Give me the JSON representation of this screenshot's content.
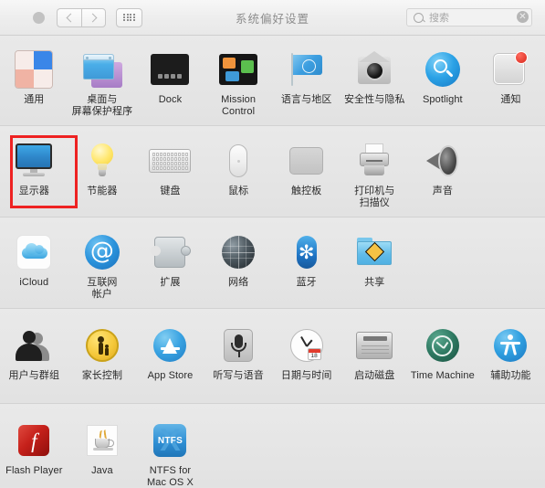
{
  "window": {
    "title": "系统偏好设置"
  },
  "toolbar": {
    "back_icon": "chevron-left-icon",
    "forward_icon": "chevron-right-icon",
    "show_all_icon": "grid-icon",
    "search": {
      "placeholder": "搜索",
      "value": "",
      "clear_label": "✕"
    }
  },
  "rows": [
    {
      "id": "row-personal",
      "items": [
        {
          "label": "通用",
          "icon": "general-icon"
        },
        {
          "label": "桌面与\n屏幕保护程序",
          "icon": "desktop-screensaver-icon"
        },
        {
          "label": "Dock",
          "icon": "dock-icon"
        },
        {
          "label": "Mission\nControl",
          "icon": "mission-control-icon"
        },
        {
          "label": "语言与地区",
          "icon": "language-region-icon"
        },
        {
          "label": "安全性与隐私",
          "icon": "security-privacy-icon"
        },
        {
          "label": "Spotlight",
          "icon": "spotlight-icon"
        },
        {
          "label": "通知",
          "icon": "notifications-icon"
        }
      ]
    },
    {
      "id": "row-hardware",
      "items": [
        {
          "label": "显示器",
          "icon": "displays-icon",
          "highlighted": true
        },
        {
          "label": "节能器",
          "icon": "energy-saver-icon"
        },
        {
          "label": "键盘",
          "icon": "keyboard-icon"
        },
        {
          "label": "鼠标",
          "icon": "mouse-icon"
        },
        {
          "label": "触控板",
          "icon": "trackpad-icon"
        },
        {
          "label": "打印机与\n扫描仪",
          "icon": "printers-scanners-icon"
        },
        {
          "label": "声音",
          "icon": "sound-icon"
        }
      ]
    },
    {
      "id": "row-internet",
      "items": [
        {
          "label": "iCloud",
          "icon": "icloud-icon"
        },
        {
          "label": "互联网\n帐户",
          "icon": "internet-accounts-icon"
        },
        {
          "label": "扩展",
          "icon": "extensions-icon"
        },
        {
          "label": "网络",
          "icon": "network-icon"
        },
        {
          "label": "蓝牙",
          "icon": "bluetooth-icon"
        },
        {
          "label": "共享",
          "icon": "sharing-icon"
        }
      ]
    },
    {
      "id": "row-system",
      "items": [
        {
          "label": "用户与群组",
          "icon": "users-groups-icon"
        },
        {
          "label": "家长控制",
          "icon": "parental-controls-icon"
        },
        {
          "label": "App Store",
          "icon": "app-store-icon"
        },
        {
          "label": "听写与语音",
          "icon": "dictation-speech-icon"
        },
        {
          "label": "日期与时间",
          "icon": "date-time-icon"
        },
        {
          "label": "启动磁盘",
          "icon": "startup-disk-icon"
        },
        {
          "label": "Time Machine",
          "icon": "time-machine-icon"
        },
        {
          "label": "辅助功能",
          "icon": "accessibility-icon"
        }
      ]
    },
    {
      "id": "row-other",
      "items": [
        {
          "label": "Flash Player",
          "icon": "flash-player-icon"
        },
        {
          "label": "Java",
          "icon": "java-icon"
        },
        {
          "label": "NTFS for\nMac OS X",
          "icon": "ntfs-icon"
        }
      ]
    }
  ],
  "misc": {
    "calendar_day": "18",
    "ntfs_label": "NTFS",
    "flash_glyph": "f",
    "at_glyph": "@",
    "bluetooth_glyph": "✻",
    "highlight_color": "#ee2222"
  }
}
